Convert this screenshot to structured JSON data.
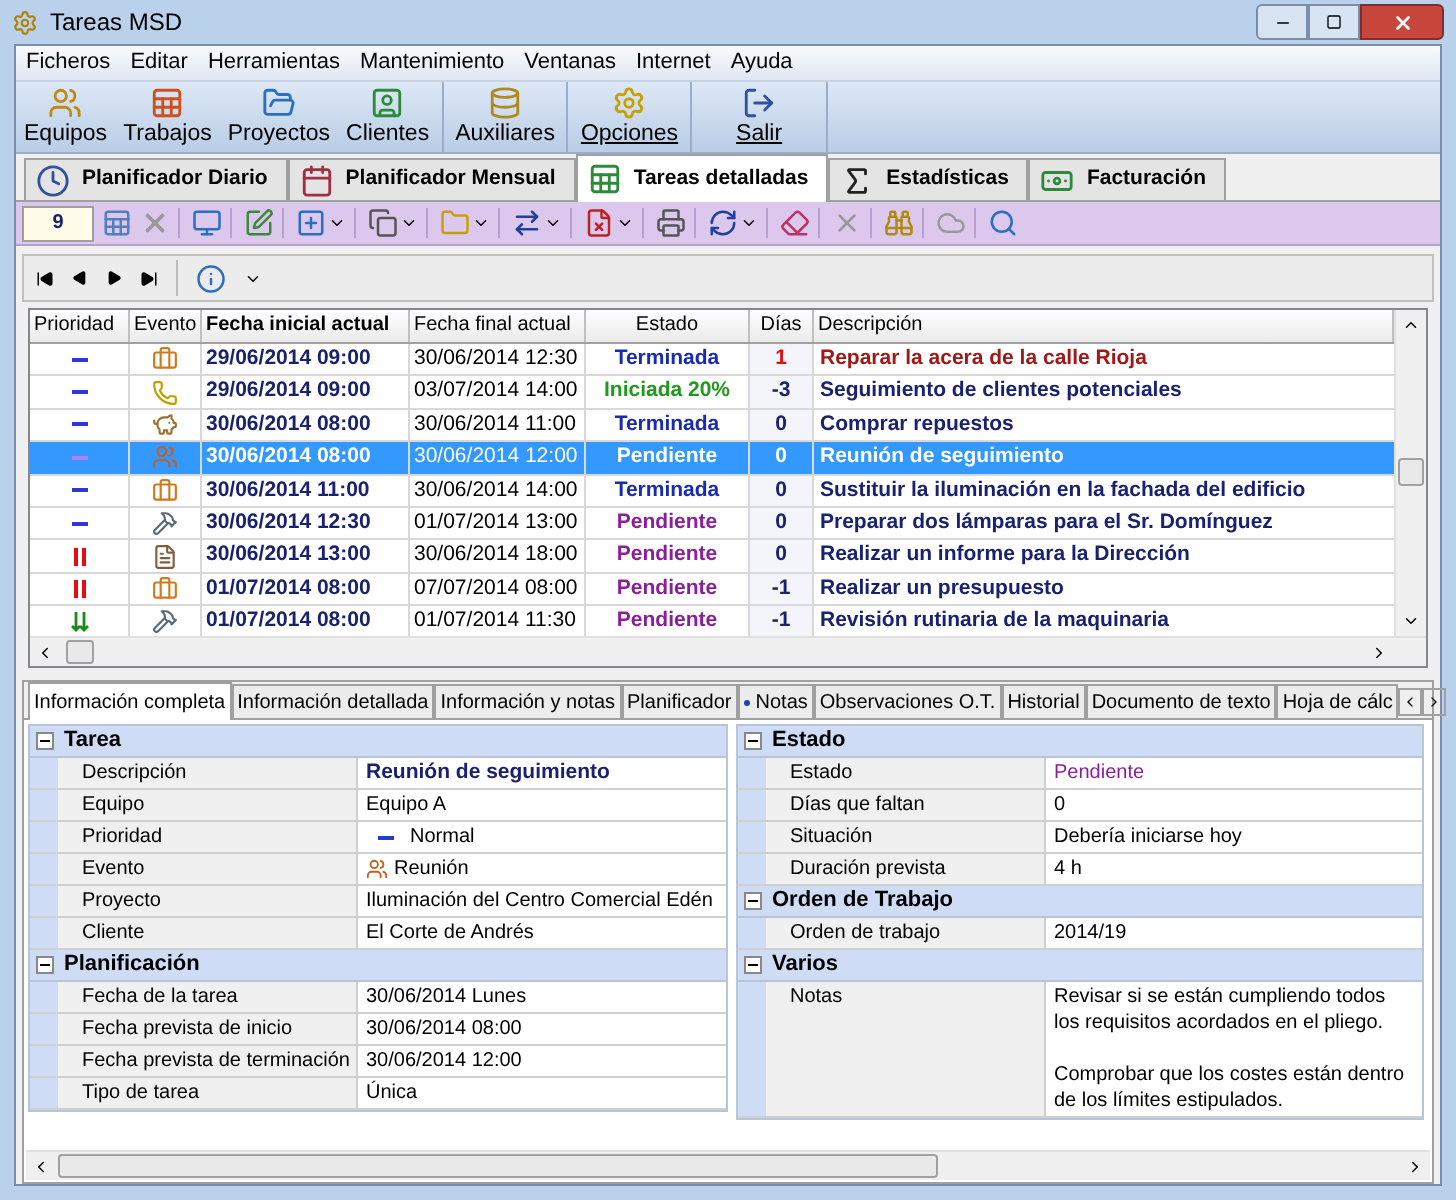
{
  "window": {
    "title": "Tareas MSD"
  },
  "menu": [
    "Ficheros",
    "Editar",
    "Herramientas",
    "Mantenimiento",
    "Ventanas",
    "Internet",
    "Ayuda"
  ],
  "main_toolbar": [
    {
      "label": "Equipos",
      "kind": "team"
    },
    {
      "label": "Trabajos",
      "kind": "jobs"
    },
    {
      "label": "Proyectos",
      "kind": "projects"
    },
    {
      "label": "Clientes",
      "kind": "clients"
    },
    {
      "label": "Auxiliares",
      "kind": "aux"
    },
    {
      "label": "Opciones",
      "kind": "options"
    },
    {
      "label": "Salir",
      "kind": "exit"
    }
  ],
  "view_tabs": [
    {
      "label": "Planificador Diario",
      "kind": "clock",
      "selected": false
    },
    {
      "label": "Planificador Mensual",
      "kind": "calendar",
      "selected": false
    },
    {
      "label": "Tareas detalladas",
      "kind": "sheet",
      "selected": true
    },
    {
      "label": "Estadísticas",
      "kind": "sigma",
      "selected": false
    },
    {
      "label": "Facturación",
      "kind": "money",
      "selected": false
    }
  ],
  "record_count": "9",
  "table": {
    "columns": [
      {
        "label": "Prioridad",
        "bold": false
      },
      {
        "label": "Evento",
        "bold": false
      },
      {
        "label": "Fecha inicial actual",
        "bold": true
      },
      {
        "label": "Fecha final actual",
        "bold": false
      },
      {
        "label": "Estado",
        "bold": false
      },
      {
        "label": "Días",
        "bold": false
      },
      {
        "label": "Descripción",
        "bold": false
      }
    ],
    "rows": [
      {
        "priority": {
          "kind": "normal"
        },
        "event": {
          "kind": "briefcase"
        },
        "start": "29/06/2014 09:00",
        "end": "30/06/2014 12:30",
        "status": {
          "text": "Terminada",
          "kind": "done"
        },
        "days": "1",
        "late": true,
        "description": "Reparar la acera de la calle Rioja",
        "selected": false
      },
      {
        "priority": {
          "kind": "normal"
        },
        "event": {
          "kind": "phone"
        },
        "start": "29/06/2014 09:00",
        "end": "03/07/2014 14:00",
        "status": {
          "text": "Iniciada 20%",
          "kind": "started"
        },
        "days": "-3",
        "late": false,
        "description": "Seguimiento de clientes potenciales",
        "selected": false
      },
      {
        "priority": {
          "kind": "normal"
        },
        "event": {
          "kind": "bag"
        },
        "start": "30/06/2014 08:00",
        "end": "30/06/2014 11:00",
        "status": {
          "text": "Terminada",
          "kind": "done"
        },
        "days": "0",
        "late": false,
        "description": "Comprar repuestos",
        "selected": false
      },
      {
        "priority": {
          "kind": "normal"
        },
        "event": {
          "kind": "people"
        },
        "start": "30/06/2014 08:00",
        "end": "30/06/2014 12:00",
        "status": {
          "text": "Pendiente",
          "kind": "pending"
        },
        "days": "0",
        "late": false,
        "description": "Reunión de seguimiento",
        "selected": true
      },
      {
        "priority": {
          "kind": "normal"
        },
        "event": {
          "kind": "briefcase"
        },
        "start": "30/06/2014 11:00",
        "end": "30/06/2014 14:00",
        "status": {
          "text": "Terminada",
          "kind": "done"
        },
        "days": "0",
        "late": false,
        "description": "Sustituir la iluminación en la fachada del edificio",
        "selected": false
      },
      {
        "priority": {
          "kind": "normal"
        },
        "event": {
          "kind": "hammer"
        },
        "start": "30/06/2014 12:30",
        "end": "01/07/2014 13:00",
        "status": {
          "text": "Pendiente",
          "kind": "pending"
        },
        "days": "0",
        "late": false,
        "description": "Preparar dos lámparas para el Sr. Domínguez",
        "selected": false
      },
      {
        "priority": {
          "kind": "high"
        },
        "event": {
          "kind": "document"
        },
        "start": "30/06/2014 13:00",
        "end": "30/06/2014 18:00",
        "status": {
          "text": "Pendiente",
          "kind": "pending"
        },
        "days": "0",
        "late": false,
        "description": "Realizar un informe para la Dirección",
        "selected": false
      },
      {
        "priority": {
          "kind": "high"
        },
        "event": {
          "kind": "briefcase"
        },
        "start": "01/07/2014 08:00",
        "end": "07/07/2014 08:00",
        "status": {
          "text": "Pendiente",
          "kind": "pending"
        },
        "days": "-1",
        "late": false,
        "description": "Realizar un presupuesto",
        "selected": false
      },
      {
        "priority": {
          "kind": "low"
        },
        "event": {
          "kind": "hammer"
        },
        "start": "01/07/2014 08:00",
        "end": "01/07/2014 11:30",
        "status": {
          "text": "Pendiente",
          "kind": "pending"
        },
        "days": "-1",
        "late": false,
        "description": "Revisión rutinaria de la maquinaria",
        "selected": false
      }
    ]
  },
  "detail_tabs": [
    {
      "label": "Información completa",
      "selected": true,
      "dot": false
    },
    {
      "label": "Información detallada",
      "selected": false,
      "dot": false
    },
    {
      "label": "Información y notas",
      "selected": false,
      "dot": false
    },
    {
      "label": "Planificador",
      "selected": false,
      "dot": false
    },
    {
      "label": "Notas",
      "selected": false,
      "dot": true
    },
    {
      "label": "Observaciones O.T.",
      "selected": false,
      "dot": false
    },
    {
      "label": "Historial",
      "selected": false,
      "dot": false
    },
    {
      "label": "Documento de texto",
      "selected": false,
      "dot": false
    },
    {
      "label": "Hoja de cálc",
      "selected": false,
      "dot": false
    }
  ],
  "left_panel": [
    {
      "title": "Tarea",
      "expanded": true,
      "rows": [
        {
          "label": "Descripción",
          "value": "Reunión de seguimiento",
          "kind": "title"
        },
        {
          "label": "Equipo",
          "value": "Equipo A",
          "kind": "text"
        },
        {
          "label": "Prioridad",
          "value": "Normal",
          "kind": "priority"
        },
        {
          "label": "Evento",
          "value": "Reunión",
          "kind": "event"
        },
        {
          "label": "Proyecto",
          "value": "Iluminación del Centro Comercial Edén",
          "kind": "text"
        },
        {
          "label": "Cliente",
          "value": "El Corte de Andrés",
          "kind": "text"
        }
      ]
    },
    {
      "title": "Planificación",
      "expanded": true,
      "rows": [
        {
          "label": "Fecha de la tarea",
          "value": "30/06/2014 Lunes",
          "kind": "text"
        },
        {
          "label": "Fecha prevista de inicio",
          "value": "30/06/2014 08:00",
          "kind": "text"
        },
        {
          "label": "Fecha prevista de terminación",
          "value": "30/06/2014 12:00",
          "kind": "text"
        },
        {
          "label": "Tipo de tarea",
          "value": "Única",
          "kind": "text"
        }
      ]
    }
  ],
  "right_panel": [
    {
      "title": "Estado",
      "expanded": true,
      "rows": [
        {
          "label": "Estado",
          "value": "Pendiente",
          "kind": "status"
        },
        {
          "label": "Días que faltan",
          "value": "0",
          "kind": "text"
        },
        {
          "label": "Situación",
          "value": "Debería iniciarse hoy",
          "kind": "text"
        },
        {
          "label": "Duración prevista",
          "value": "4 h",
          "kind": "text"
        }
      ]
    },
    {
      "title": "Orden de Trabajo",
      "expanded": true,
      "rows": [
        {
          "label": "Orden de trabajo",
          "value": "2014/19",
          "kind": "text"
        }
      ]
    },
    {
      "title": "Varios",
      "expanded": true,
      "rows": [
        {
          "label": "Notas",
          "value": "Revisar si se están cumpliendo todos los requisitos acordados en el pliego.\n\nComprobar que los costes están dentro de los límites estipulados.",
          "kind": "text"
        }
      ]
    }
  ]
}
